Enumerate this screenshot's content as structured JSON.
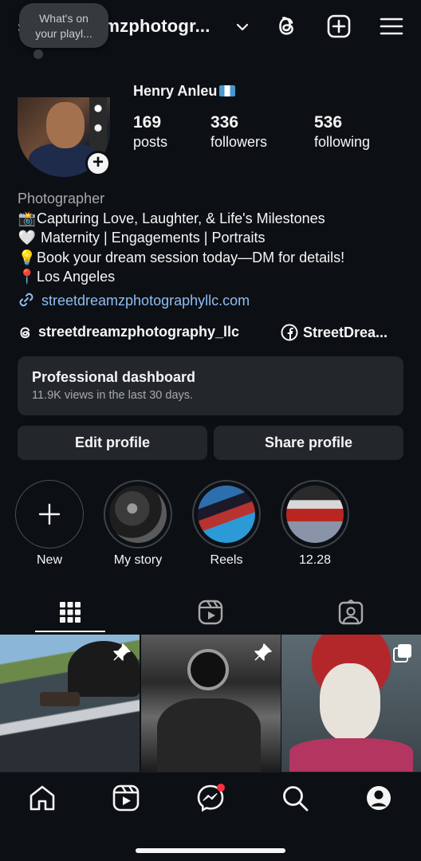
{
  "header": {
    "username": "streetdreamzphotogr...",
    "icons": [
      "chevron-down-icon",
      "threads-icon",
      "create-icon",
      "menu-icon"
    ]
  },
  "profile": {
    "note": [
      "What's on",
      "your playl..."
    ],
    "full_name": "Henry Anleu",
    "stats": [
      {
        "num": "169",
        "label": "posts"
      },
      {
        "num": "336",
        "label": "followers"
      },
      {
        "num": "536",
        "label": "following"
      }
    ],
    "add_badge": "+"
  },
  "bio": {
    "category": "Photographer",
    "lines": [
      {
        "emoji": "📸",
        "text": "Capturing Love, Laughter, & Life's Milestones"
      },
      {
        "emoji": "🤍",
        "text": " Maternity | Engagements | Portraits"
      },
      {
        "emoji": "💡",
        "text": "Book your dream session today—DM for details!"
      },
      {
        "emoji": "📍",
        "text": "Los Angeles"
      }
    ],
    "link": "streetdreamzphotographyllc.com",
    "threads_handle": "streetdreamzphotography_llc",
    "facebook_handle": "StreetDrea..."
  },
  "dashboard": {
    "title": "Professional dashboard",
    "subtitle": "11.9K views in the last 30 days."
  },
  "buttons": {
    "edit": "Edit profile",
    "share": "Share profile"
  },
  "highlights": [
    {
      "label": "New"
    },
    {
      "label": "My story"
    },
    {
      "label": "Reels"
    },
    {
      "label": "12.28"
    }
  ],
  "tabs": [
    "grid-icon",
    "reels-icon",
    "tagged-icon"
  ],
  "colors": {
    "background": "#0c1014",
    "surface": "#23272c",
    "link": "#8fbdf2",
    "notification": "#ff3040"
  },
  "nav": [
    "home-icon",
    "reels-icon",
    "messenger-icon",
    "search-icon",
    "profile-icon"
  ]
}
